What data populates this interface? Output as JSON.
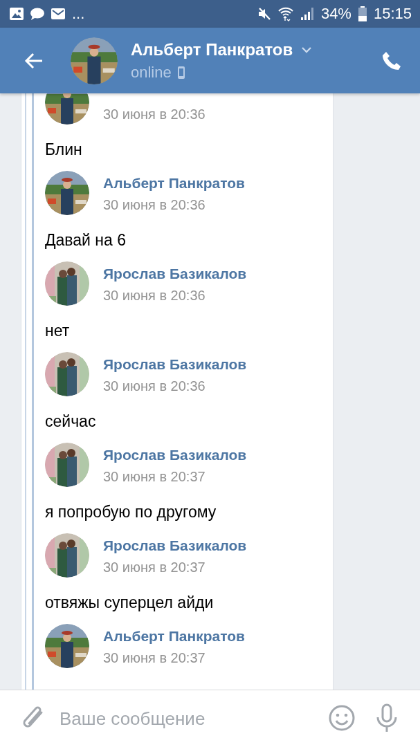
{
  "status_bar": {
    "more": "...",
    "battery": "34%",
    "time": "15:15"
  },
  "header": {
    "title": "Альберт Панкратов",
    "presence": "online"
  },
  "messages": [
    {
      "kind": "self",
      "date": "30 июня в 20:36",
      "text": "Блин"
    },
    {
      "kind": "self",
      "author": "Альберт Панкратов",
      "date": "30 июня в 20:36",
      "text": "Давай на 6"
    },
    {
      "kind": "peer",
      "author": "Ярослав Базикалов",
      "date": "30 июня в 20:36",
      "text": "нет"
    },
    {
      "kind": "peer",
      "author": "Ярослав Базикалов",
      "date": "30 июня в 20:36",
      "text": "сейчас"
    },
    {
      "kind": "peer",
      "author": "Ярослав Базикалов",
      "date": "30 июня в 20:37",
      "text": "я попробую по другому"
    },
    {
      "kind": "peer",
      "author": "Ярослав Базикалов",
      "date": "30 июня в 20:37",
      "text": "отвяжы суперцел айди"
    },
    {
      "kind": "self",
      "author": "Альберт Панкратов",
      "date": "30 июня в 20:37"
    }
  ],
  "composer": {
    "placeholder": "Ваше сообщение"
  }
}
